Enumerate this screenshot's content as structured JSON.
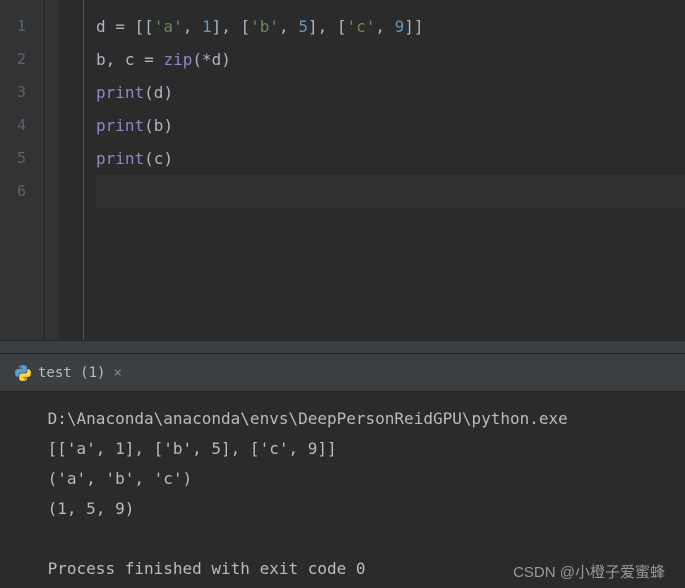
{
  "editor": {
    "lines": [
      {
        "num": "1",
        "tokens": [
          {
            "t": "d ",
            "c": "py-var"
          },
          {
            "t": "= [[",
            "c": "py-op"
          },
          {
            "t": "'a'",
            "c": "py-str"
          },
          {
            "t": ", ",
            "c": "py-op"
          },
          {
            "t": "1",
            "c": "py-num"
          },
          {
            "t": "], [",
            "c": "py-op"
          },
          {
            "t": "'b'",
            "c": "py-str"
          },
          {
            "t": ", ",
            "c": "py-op"
          },
          {
            "t": "5",
            "c": "py-num"
          },
          {
            "t": "], [",
            "c": "py-op"
          },
          {
            "t": "'c'",
            "c": "py-str"
          },
          {
            "t": ", ",
            "c": "py-op"
          },
          {
            "t": "9",
            "c": "py-num"
          },
          {
            "t": "]]",
            "c": "py-op"
          }
        ]
      },
      {
        "num": "2",
        "tokens": [
          {
            "t": "b",
            "c": "py-var"
          },
          {
            "t": ", ",
            "c": "py-op"
          },
          {
            "t": "c ",
            "c": "py-var"
          },
          {
            "t": "= ",
            "c": "py-op"
          },
          {
            "t": "zip",
            "c": "py-builtin"
          },
          {
            "t": "(*d)",
            "c": "py-op"
          }
        ]
      },
      {
        "num": "3",
        "tokens": [
          {
            "t": "print",
            "c": "py-builtin"
          },
          {
            "t": "(d)",
            "c": "py-op"
          }
        ]
      },
      {
        "num": "4",
        "tokens": [
          {
            "t": "print",
            "c": "py-builtin"
          },
          {
            "t": "(b)",
            "c": "py-op"
          }
        ]
      },
      {
        "num": "5",
        "tokens": [
          {
            "t": "print",
            "c": "py-builtin"
          },
          {
            "t": "(c)",
            "c": "py-op"
          }
        ]
      },
      {
        "num": "6",
        "tokens": []
      }
    ]
  },
  "run_tab": {
    "label": "test (1)",
    "close": "×"
  },
  "console": {
    "lines": [
      "D:\\Anaconda\\anaconda\\envs\\DeepPersonReidGPU\\python.exe",
      "[['a', 1], ['b', 5], ['c', 9]]",
      "('a', 'b', 'c')",
      "(1, 5, 9)",
      "",
      "Process finished with exit code 0"
    ]
  },
  "watermark": "CSDN @小橙子爱蜜蜂"
}
